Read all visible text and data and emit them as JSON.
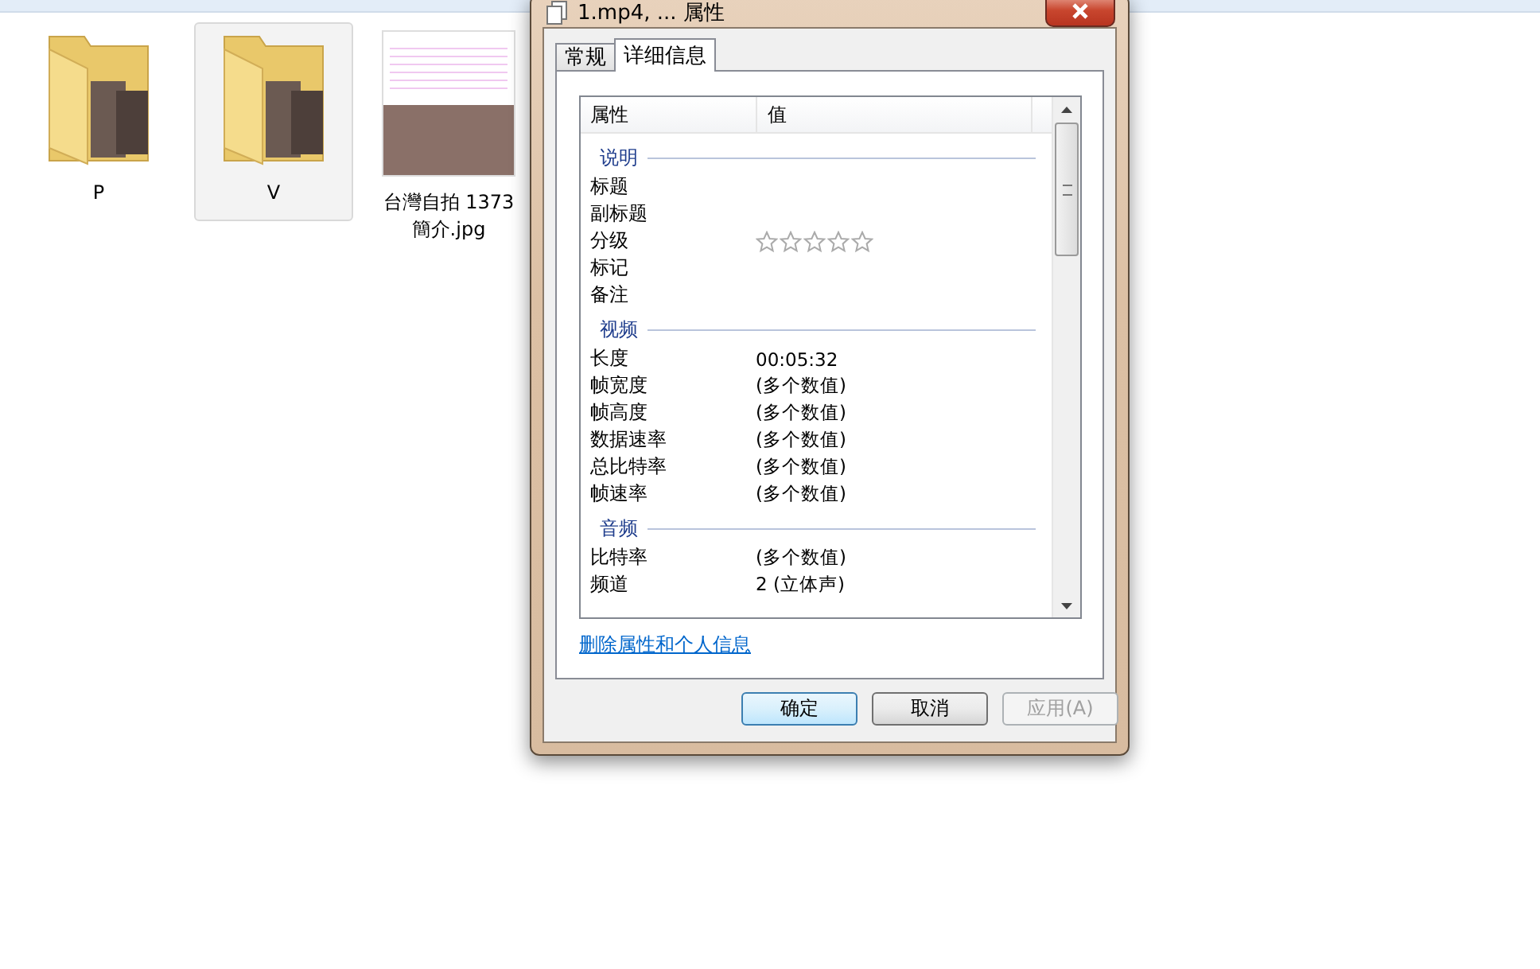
{
  "files": [
    {
      "name": "P",
      "kind": "folder",
      "selected": false
    },
    {
      "name": "V",
      "kind": "folder",
      "selected": true
    },
    {
      "name": "台灣自拍 1373 簡介.jpg",
      "kind": "image",
      "selected": false
    }
  ],
  "dialog": {
    "title": "1.mp4, ... 属性",
    "tabs": [
      {
        "label": "常规",
        "selected": false
      },
      {
        "label": "详细信息",
        "selected": true
      }
    ],
    "columns": [
      "属性",
      "值"
    ],
    "sections": [
      {
        "title": "说明",
        "rows": [
          {
            "property": "标题"
          },
          {
            "property": "副标题"
          },
          {
            "property": "分级",
            "kind": "stars",
            "stars": 0
          },
          {
            "property": "标记"
          },
          {
            "property": "备注"
          }
        ]
      },
      {
        "title": "视频",
        "rows": [
          {
            "property": "长度",
            "value": "00:05:32"
          },
          {
            "property": "帧宽度",
            "value": "(多个数值)"
          },
          {
            "property": "帧高度",
            "value": "(多个数值)"
          },
          {
            "property": "数据速率",
            "value": "(多个数值)"
          },
          {
            "property": "总比特率",
            "value": "(多个数值)"
          },
          {
            "property": "帧速率",
            "value": "(多个数值)"
          }
        ]
      },
      {
        "title": "音频",
        "rows": [
          {
            "property": "比特率",
            "value": "(多个数值)"
          },
          {
            "property": "频道",
            "value": "2 (立体声)"
          }
        ]
      }
    ],
    "link": "删除属性和个人信息",
    "buttons": [
      {
        "label": "确定",
        "default": true,
        "disabled": false
      },
      {
        "label": "取消",
        "default": false,
        "disabled": false
      },
      {
        "label": "应用(A)",
        "default": false,
        "disabled": true
      }
    ]
  }
}
